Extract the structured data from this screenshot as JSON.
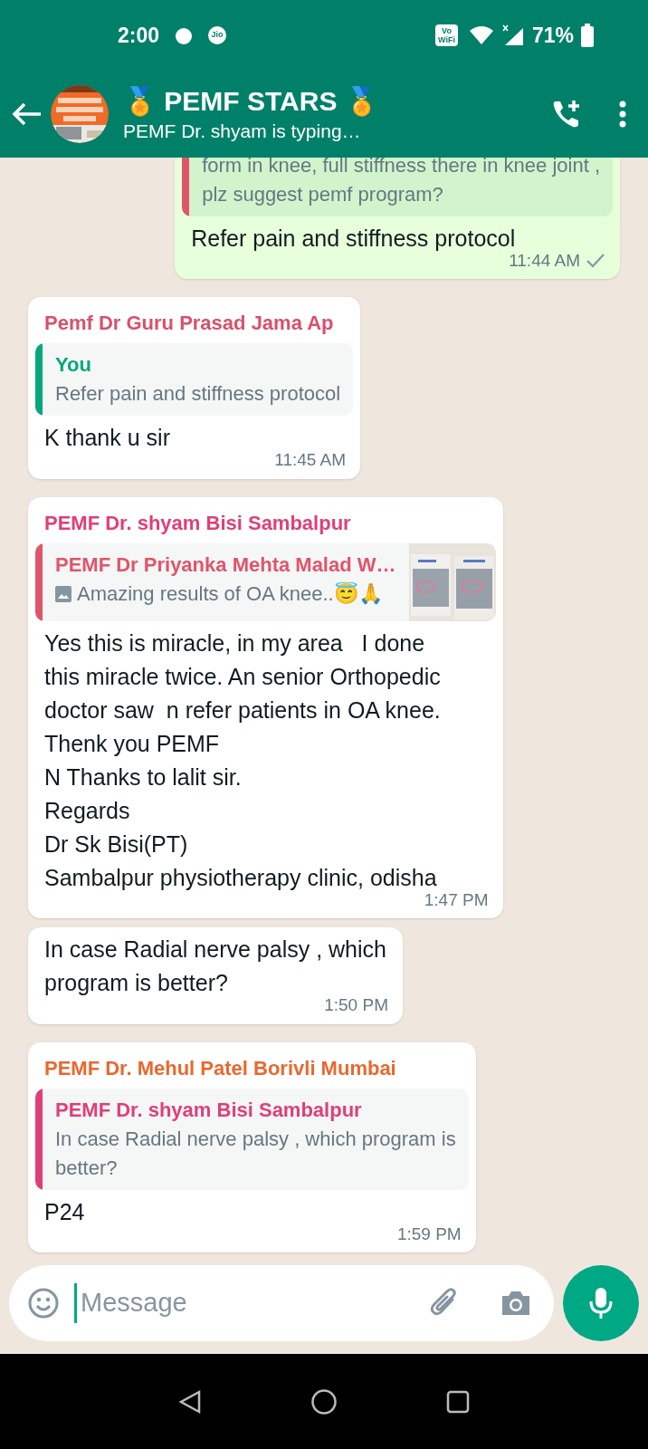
{
  "status_bar": {
    "time": "2:00",
    "carrier": "Jio",
    "wifi_calling": [
      "Vo",
      "WiFi"
    ],
    "battery_text": "71%"
  },
  "header": {
    "title": "🏅 PEMF STARS 🏅",
    "subtitle": "PEMF Dr. shyam is typing…"
  },
  "messages": [
    {
      "kind": "outgoing",
      "quote": {
        "color": "#e0556a",
        "text": "form in knee, full stiffness there in knee joint ,\nplz suggest pemf program?"
      },
      "text": "Refer pain and stiffness protocol",
      "time": "11:44 AM"
    },
    {
      "kind": "incoming",
      "sender": "Pemf Dr Guru Prasad Jama Ap",
      "color": "#d9506a",
      "quote": {
        "author": "You",
        "color": "#06a77d",
        "text": "Refer pain and stiffness protocol"
      },
      "text": "K thank u sir",
      "time": "11:45 AM"
    },
    {
      "kind": "incoming",
      "sender": "PEMF Dr. shyam Bisi Sambalpur",
      "color": "#df3f78",
      "quote": {
        "author": "PEMF Dr Priyanka Mehta Malad W…",
        "color": "#e0556a",
        "text": "Amazing results of OA knee..😇🙏",
        "thumbnail": true
      },
      "text": "Yes this is miracle, in my area   I done\nthis miracle twice. An senior Orthopedic\ndoctor saw  n refer patients in OA knee.\nThenk you PEMF\nN Thanks to lalit sir.\nRegards\nDr Sk Bisi(PT)\nSambalpur physiotherapy clinic, odisha",
      "time": "1:47 PM"
    },
    {
      "kind": "incoming",
      "text": "In case Radial nerve palsy , which\nprogram is better?",
      "time": "1:50 PM"
    },
    {
      "kind": "incoming",
      "sender": "PEMF Dr. Mehul Patel Borivli Mumbai",
      "color": "#e9682f",
      "quote": {
        "author": "PEMF Dr. shyam Bisi Sambalpur",
        "color": "#df3f78",
        "text": "In case Radial nerve palsy , which program is\nbetter?"
      },
      "text": "P24",
      "time": "1:59 PM"
    }
  ],
  "composer": {
    "placeholder": "Message"
  }
}
